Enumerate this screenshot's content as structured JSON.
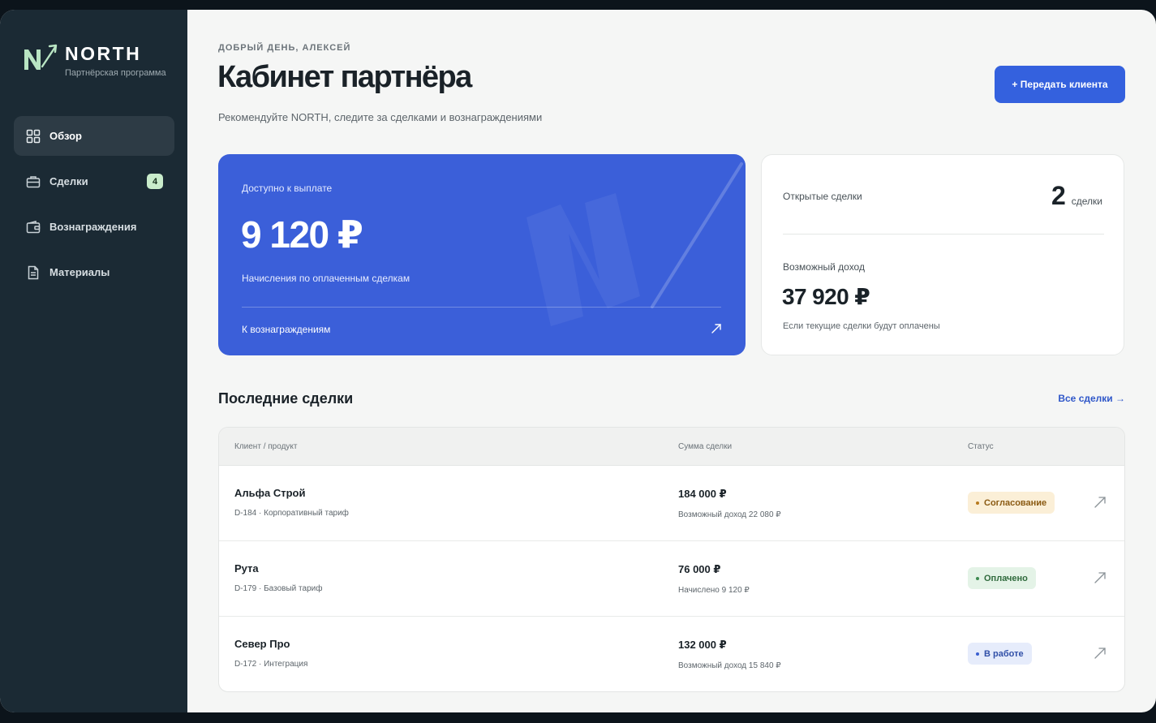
{
  "brand": {
    "name": "NORTH",
    "subtitle": "Партнёрская программа"
  },
  "sidebar": {
    "items": [
      {
        "label": "Обзор",
        "icon": "grid-icon",
        "active": true
      },
      {
        "label": "Сделки",
        "icon": "briefcase-icon",
        "badge": "4"
      },
      {
        "label": "Вознаграждения",
        "icon": "wallet-icon"
      },
      {
        "label": "Материалы",
        "icon": "document-icon"
      }
    ]
  },
  "header": {
    "greeting": "ДОБРЫЙ ДЕНЬ, АЛЕКСЕЙ",
    "title": "Кабинет партнёра",
    "subtitle": "Рекомендуйте NORTH, следите за сделками и вознаграждениями",
    "cta_label": "+ Передать клиента"
  },
  "payout": {
    "label": "Доступно к выплате",
    "amount": "9 120 ₽",
    "note": "Начисления по оплаченным сделкам",
    "link": "К вознаграждениям"
  },
  "stats": {
    "open_label": "Открытые сделки",
    "open_count": "2",
    "open_unit": "сделки",
    "income_label": "Возможный доход",
    "income_amount": "37 920 ₽",
    "income_note": "Если текущие сделки будут оплачены"
  },
  "deals": {
    "title": "Последние сделки",
    "all_link": "Все сделки →",
    "columns": [
      "Клиент / продукт",
      "Сумма сделки",
      "Статус"
    ],
    "rows": [
      {
        "client": "Альфа Строй",
        "meta": "D-184 · Корпоративный тариф",
        "amount": "184 000 ₽",
        "sub": "Возможный доход 22 080 ₽",
        "status": "Согласование",
        "status_kind": "pending"
      },
      {
        "client": "Рута",
        "meta": "D-179 · Базовый тариф",
        "amount": "76 000 ₽",
        "sub": "Начислено 9 120 ₽",
        "status": "Оплачено",
        "status_kind": "paid"
      },
      {
        "client": "Север Про",
        "meta": "D-172 · Интеграция",
        "amount": "132 000 ₽",
        "sub": "Возможный доход 15 840 ₽",
        "status": "В работе",
        "status_kind": "progress"
      }
    ]
  },
  "colors": {
    "accent": "#3461de",
    "sidebar_bg": "#1b2a34",
    "brand_green": "#b9e5c3",
    "status_pending_bg": "#fbefd7",
    "status_pending_fg": "#8a5a12",
    "status_paid_bg": "#e4f3e7",
    "status_paid_fg": "#2f6a3c",
    "status_progress_bg": "#e6ecfb",
    "status_progress_fg": "#3150a8"
  }
}
